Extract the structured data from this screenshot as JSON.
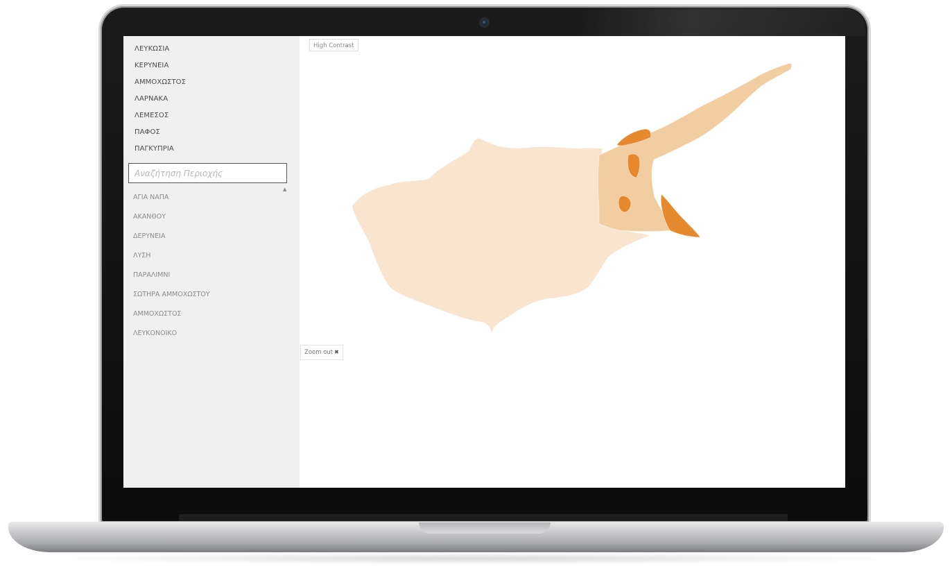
{
  "sidebar": {
    "regions": [
      "ΛΕΥΚΩΣΙΑ",
      "ΚΕΡΥΝΕΙΑ",
      "ΑΜΜΟΧΩΣΤΟΣ",
      "ΛΑΡΝΑΚΑ",
      "ΛΕΜΕΣΟΣ",
      "ΠΑΦΟΣ",
      "ΠΑΓΚΥΠΡΙΑ"
    ],
    "search_placeholder": "Αναζήτηση Περιοχής",
    "towns": [
      "ΑΓΙΑ ΝΑΠΑ",
      "ΑΚΑΝΘΟΥ",
      "ΔΕΡΥΝΕΙΑ",
      "ΛΥΣΗ",
      "ΠΑΡΑΛΙΜΝΙ",
      "ΣΩΤΗΡΑ ΑΜΜΟΧΩΣΤΟΥ",
      "ΑΜΜΟΧΩΣΤΟΣ",
      "ΛΕΥΚΟΝΟΙΚΟ"
    ]
  },
  "map": {
    "high_contrast_label": "High Contrast",
    "zoom_out_label": "Zoom out",
    "zoom_out_icon": "close-icon",
    "colors": {
      "base_fill": "#f8e4cf",
      "district_fill": "#f1cda1",
      "highlight_fill": "#e6892e"
    }
  }
}
